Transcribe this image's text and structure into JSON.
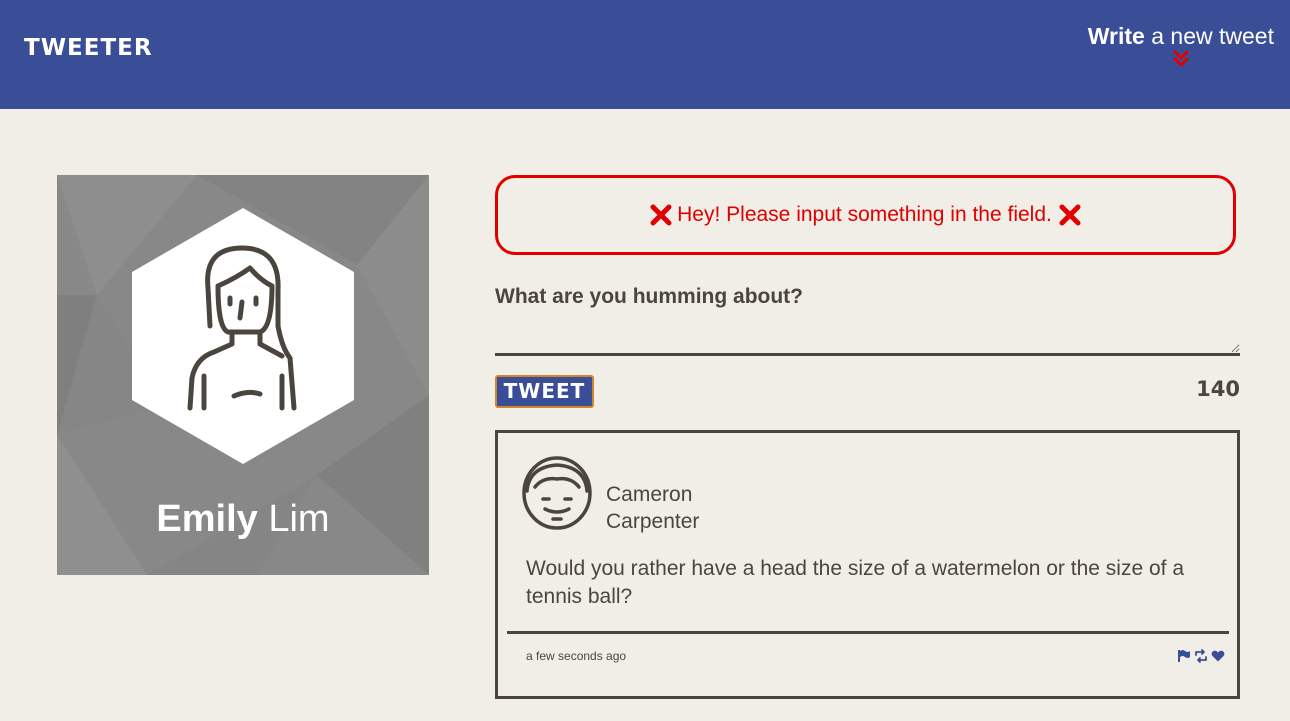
{
  "header": {
    "brand": "TWEETER",
    "compose_bold": "Write",
    "compose_rest": "a new tweet"
  },
  "profile": {
    "first_name": "Emily",
    "last_name": "Lim"
  },
  "composer": {
    "error_message": "Hey! Please input something in the field.",
    "error_icon": "x-mark-icon",
    "prompt_label": "What are you humming about?",
    "text_value": "",
    "submit_label": "TWEET",
    "char_counter": "140"
  },
  "tweets": [
    {
      "author_first": "Cameron",
      "author_last": "Carpenter",
      "text": "Would you rather have a head the size of a watermelon or the size of a tennis ball?",
      "timestamp": "a few seconds ago",
      "actions": [
        "flag-icon",
        "retweet-icon",
        "heart-icon"
      ]
    }
  ],
  "colors": {
    "header_bg": "#3a4d97",
    "page_bg": "#f1eee8",
    "error": "#e00000",
    "text": "#4a463f",
    "accent_red": "#e00000"
  }
}
